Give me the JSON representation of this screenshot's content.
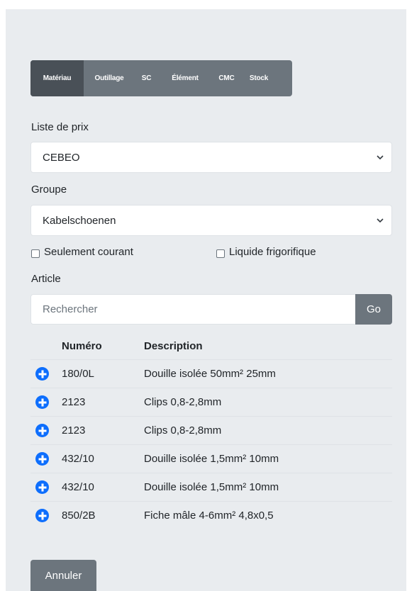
{
  "tabs": [
    "Matériau",
    "Outillage",
    "SC",
    "Élément",
    "CMC",
    "Stock"
  ],
  "active_tab": 0,
  "price_list": {
    "label": "Liste de prix",
    "value": "CEBEO"
  },
  "group": {
    "label": "Groupe",
    "value": "Kabelschoenen"
  },
  "checks": {
    "current_only": "Seulement courant",
    "refrigerant": "Liquide frigorifique"
  },
  "article": {
    "label": "Article",
    "placeholder": "Rechercher",
    "go_label": "Go"
  },
  "table": {
    "headers": {
      "number": "Numéro",
      "description": "Description"
    },
    "rows": [
      {
        "number": "180/0L",
        "description": "Douille isolée 50mm² 25mm"
      },
      {
        "number": "2123",
        "description": "Clips 0,8-2,8mm"
      },
      {
        "number": "2123",
        "description": "Clips 0,8-2,8mm"
      },
      {
        "number": "432/10",
        "description": "Douille isolée 1,5mm² 10mm"
      },
      {
        "number": "432/10",
        "description": "Douille isolée 1,5mm² 10mm"
      },
      {
        "number": "850/2B",
        "description": "Fiche mâle 4-6mm² 4,8x0,5"
      }
    ]
  },
  "cancel_label": "Annuler",
  "colors": {
    "primary": "#0d6efd",
    "secondary": "#6c757d",
    "panel": "#e9ecef"
  }
}
